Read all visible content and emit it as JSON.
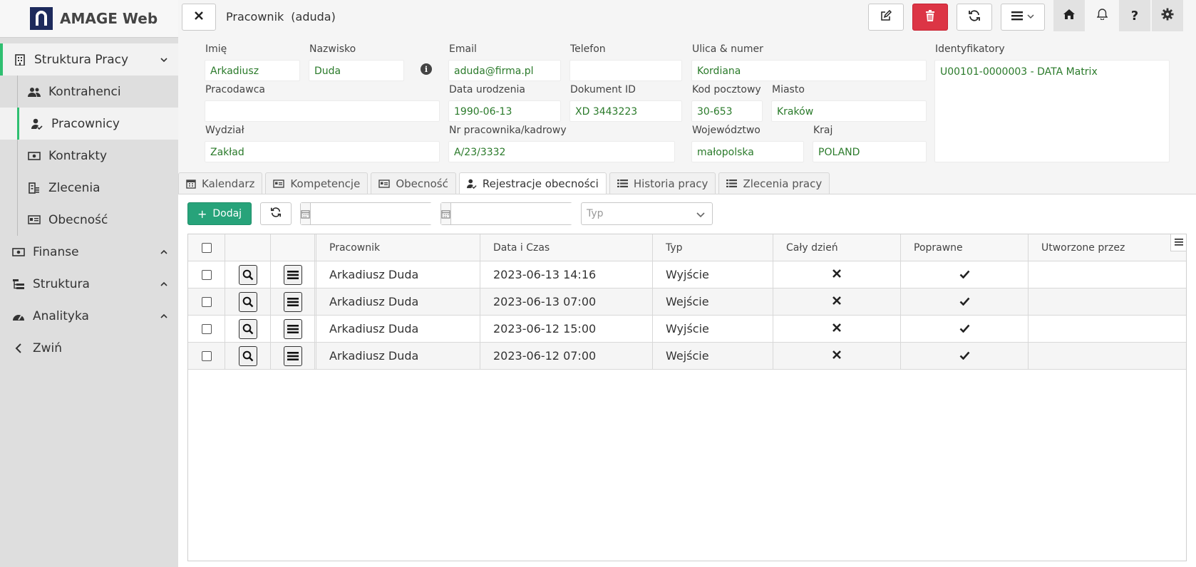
{
  "app": {
    "title": "AMAGE Web"
  },
  "sidebar": {
    "sections": [
      {
        "label": "Struktura Pracy",
        "icon": "building-icon",
        "expanded": true
      },
      {
        "label": "Finanse",
        "icon": "money-icon"
      },
      {
        "label": "Struktura",
        "icon": "hierarchy-icon"
      },
      {
        "label": "Analityka",
        "icon": "dashboard-icon"
      }
    ],
    "items": [
      {
        "label": "Kontrahenci",
        "icon": "users-icon"
      },
      {
        "label": "Pracownicy",
        "icon": "user-check-icon",
        "active": true
      },
      {
        "label": "Kontrakty",
        "icon": "money-icon"
      },
      {
        "label": "Zlecenia",
        "icon": "building-list-icon"
      },
      {
        "label": "Obecność",
        "icon": "id-card-icon"
      }
    ],
    "collapse_label": "Zwiń"
  },
  "header": {
    "title": "Pracownik",
    "subtitle": "(aduda)"
  },
  "toolbar_colors": {
    "delete": "#dc3545",
    "accent": "#27a37a",
    "active_border": "#2fbf71",
    "field_text": "#2a7a2a"
  },
  "form": {
    "imie": {
      "label": "Imię",
      "value": "Arkadiusz"
    },
    "nazwisko": {
      "label": "Nazwisko",
      "value": "Duda"
    },
    "email": {
      "label": "Email",
      "value": "aduda@firma.pl"
    },
    "telefon": {
      "label": "Telefon",
      "value": ""
    },
    "ulica": {
      "label": "Ulica & numer",
      "value": "Kordiana"
    },
    "identyfikatory": {
      "label": "Identyfikatory",
      "value": "U00101-0000003 - DATA Matrix"
    },
    "pracodawca": {
      "label": "Pracodawca",
      "value": ""
    },
    "data_urodzenia": {
      "label": "Data urodzenia",
      "value": "1990-06-13"
    },
    "dokument": {
      "label": "Dokument ID",
      "value": "XD 3443223"
    },
    "kod": {
      "label": "Kod pocztowy",
      "value": "30-653"
    },
    "miasto": {
      "label": "Miasto",
      "value": "Kraków"
    },
    "wydzial": {
      "label": "Wydział",
      "value": "Zakład"
    },
    "nr_pracownika": {
      "label": "Nr pracownika/kadrowy",
      "value": "A/23/3332"
    },
    "wojewodztwo": {
      "label": "Województwo",
      "value": "małopolska"
    },
    "kraj": {
      "label": "Kraj",
      "value": "POLAND"
    }
  },
  "tabs": [
    {
      "label": "Kalendarz",
      "icon": "calendar-icon"
    },
    {
      "label": "Kompetencje",
      "icon": "id-card-icon"
    },
    {
      "label": "Obecność",
      "icon": "id-card-icon"
    },
    {
      "label": "Rejestracje obecności",
      "icon": "user-check-icon",
      "active": true
    },
    {
      "label": "Historia pracy",
      "icon": "list-icon"
    },
    {
      "label": "Zlecenia pracy",
      "icon": "list-icon"
    }
  ],
  "panel": {
    "add_label": "Dodaj",
    "date_from": "",
    "date_to": "",
    "type_placeholder": "Typ"
  },
  "table": {
    "columns": [
      "Pracownik",
      "Data i Czas",
      "Typ",
      "Cały dzień",
      "Poprawne",
      "Utworzone przez"
    ],
    "rows": [
      {
        "pracownik": "Arkadiusz Duda",
        "data": "2023-06-13 14:16",
        "typ": "Wyjście",
        "caly_dzien": false,
        "poprawne": true,
        "utworzone": ""
      },
      {
        "pracownik": "Arkadiusz Duda",
        "data": "2023-06-13 07:00",
        "typ": "Wejście",
        "caly_dzien": false,
        "poprawne": true,
        "utworzone": ""
      },
      {
        "pracownik": "Arkadiusz Duda",
        "data": "2023-06-12 15:00",
        "typ": "Wyjście",
        "caly_dzien": false,
        "poprawne": true,
        "utworzone": ""
      },
      {
        "pracownik": "Arkadiusz Duda",
        "data": "2023-06-12 07:00",
        "typ": "Wejście",
        "caly_dzien": false,
        "poprawne": true,
        "utworzone": ""
      }
    ]
  }
}
